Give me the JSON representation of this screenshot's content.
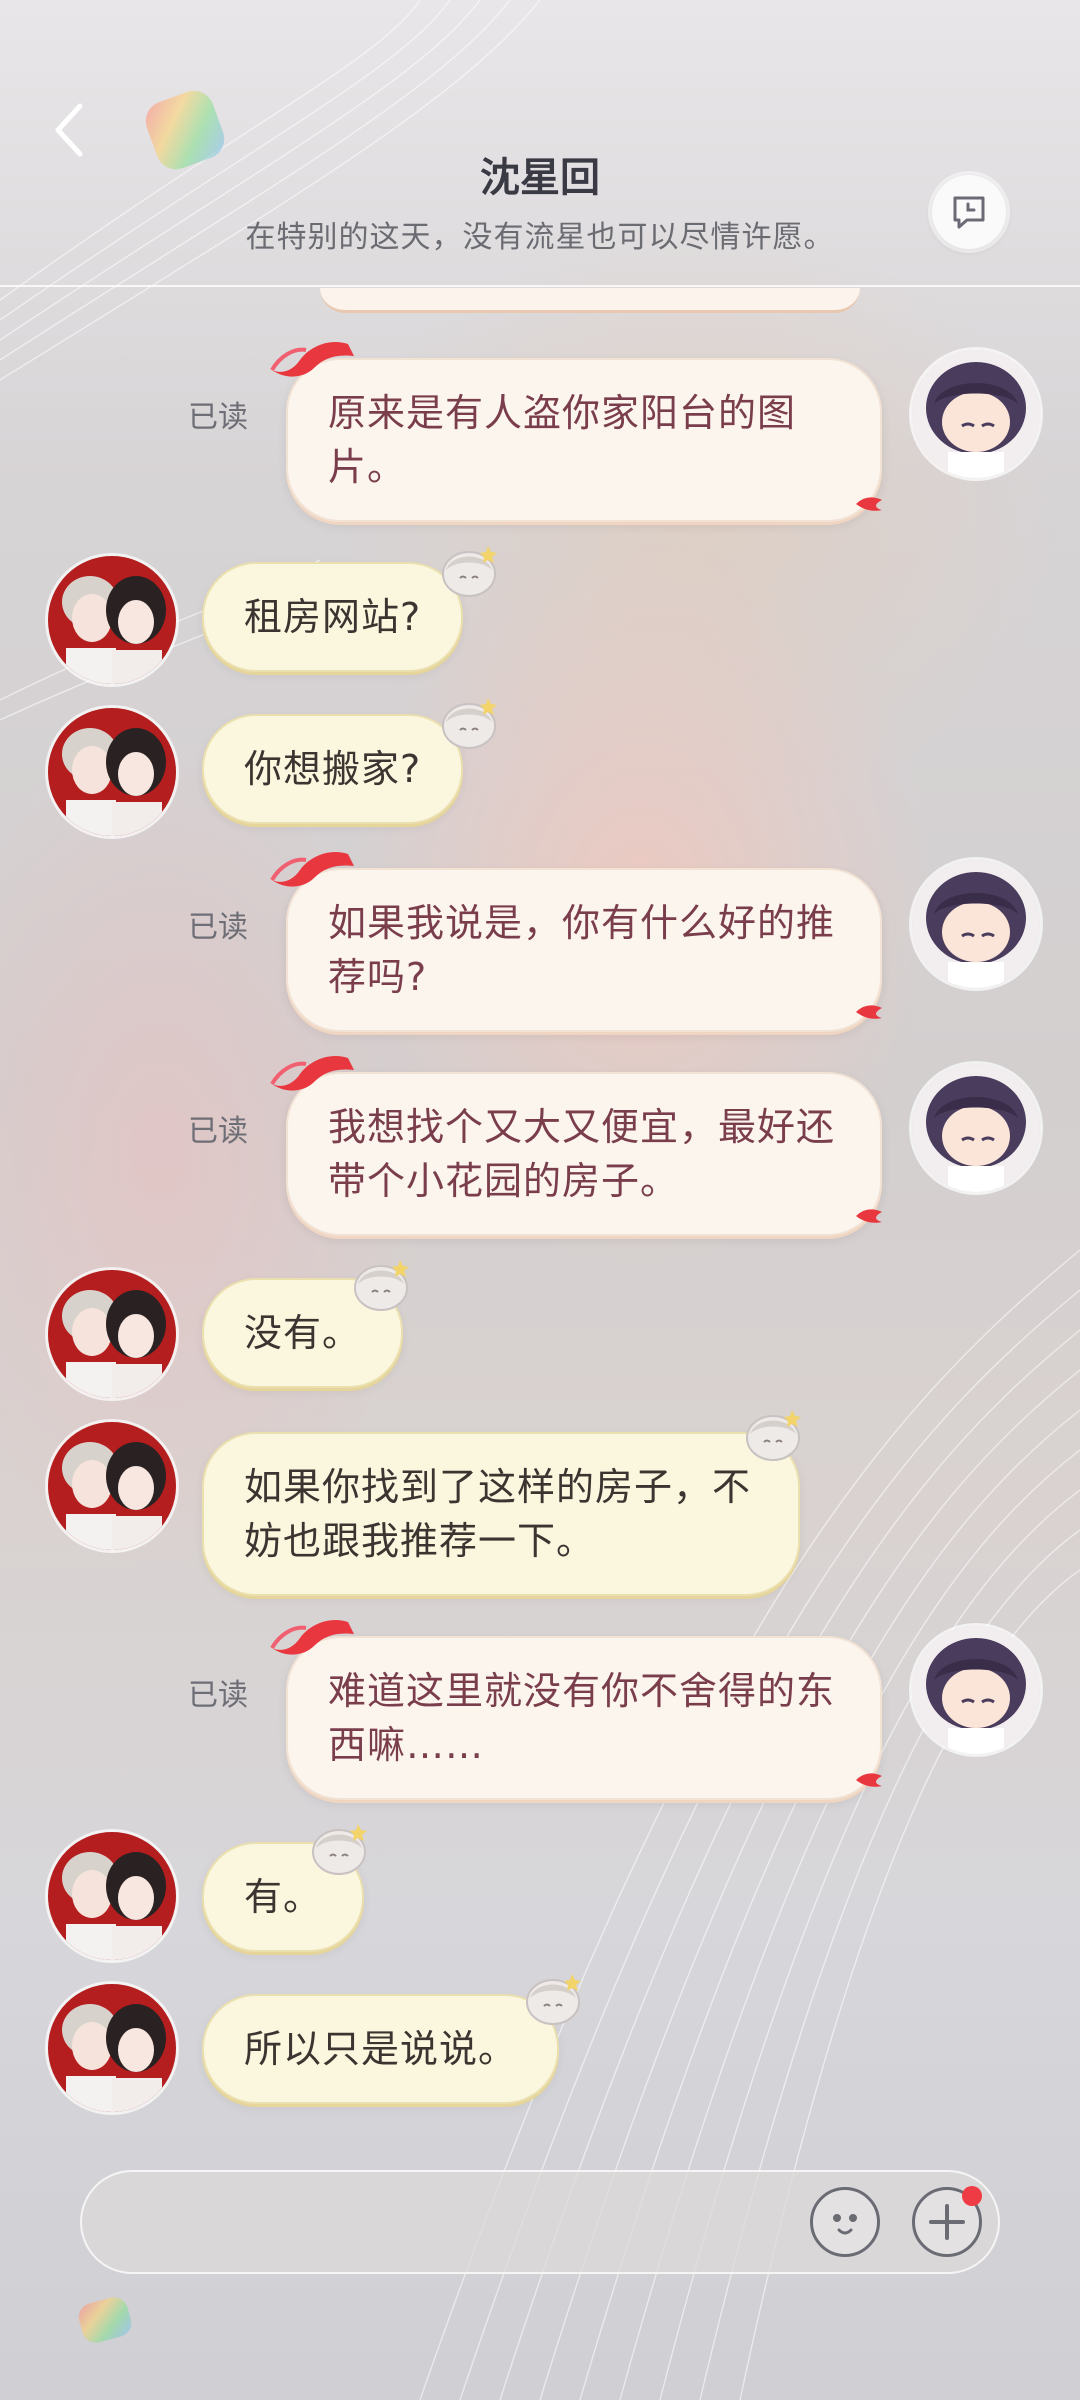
{
  "header": {
    "title": "沈星回",
    "subtitle": "在特别的这天，没有流星也可以尽情许愿。"
  },
  "read_label": "已读",
  "messages": [
    {
      "from": "me",
      "text": "原来是有人盗你家阳台的图片。",
      "read": true
    },
    {
      "from": "other",
      "text": "租房网站?"
    },
    {
      "from": "other",
      "text": "你想搬家?"
    },
    {
      "from": "me",
      "text": "如果我说是，你有什么好的推荐吗?",
      "read": true
    },
    {
      "from": "me",
      "text": "我想找个又大又便宜，最好还带个小花园的房子。",
      "read": true
    },
    {
      "from": "other",
      "text": "没有。"
    },
    {
      "from": "other",
      "text": "如果你找到了这样的房子，不妨也跟我推荐一下。"
    },
    {
      "from": "me",
      "text": "难道这里就没有你不舍得的东西嘛……",
      "read": true
    },
    {
      "from": "other",
      "text": "有。"
    },
    {
      "from": "other",
      "text": "所以只是说说。"
    }
  ],
  "input": {
    "placeholder": "",
    "has_notification": true
  },
  "icons": {
    "back": "back-chevron-icon",
    "header_button": "chat-bubble-icon",
    "emoji": "emoji-face-icon",
    "plus": "plus-icon",
    "reader_badge": "red-fish-icon",
    "sender_badge": "chibi-head-icon"
  },
  "colors": {
    "my_bubble": "#fcf5ee",
    "my_text": "#7a3d4c",
    "other_bubble": "#fbf7df",
    "other_text": "#3b3430",
    "notification_dot": "#ef3b44"
  }
}
